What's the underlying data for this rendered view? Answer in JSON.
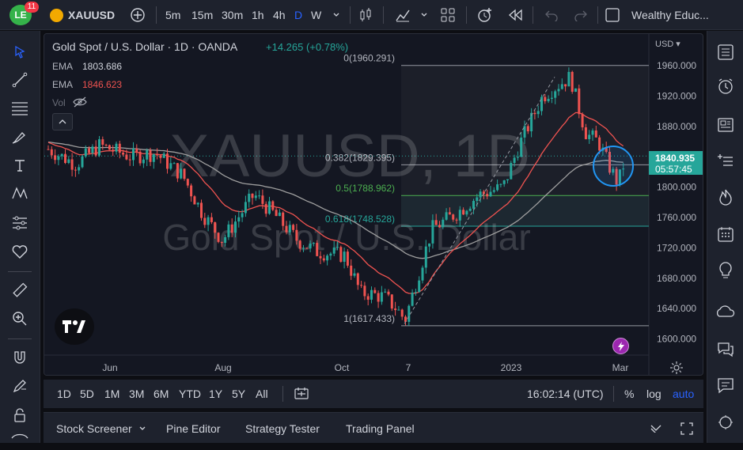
{
  "header": {
    "logo_badge": "11",
    "symbol": "XAUUSD",
    "intervals": [
      "5m",
      "15m",
      "30m",
      "1h",
      "4h",
      "D",
      "W"
    ],
    "active_interval": "D",
    "workspace": "Wealthy Educ..."
  },
  "legend": {
    "title": "Gold Spot / U.S. Dollar · 1D · OANDA",
    "change": "+14.265 (+0.78%)",
    "ema1_label": "EMA",
    "ema1_value": "1803.686",
    "ema2_label": "EMA",
    "ema2_value": "1846.623",
    "vol_label": "Vol"
  },
  "watermark": {
    "symbol": "XAUUSD, 1D",
    "name": "Gold Spot / U.S. Dollar"
  },
  "fib": {
    "level_0": "0(1960.291)",
    "level_382": "0.382(1829.395)",
    "level_5": "0.5(1788.962)",
    "level_618": "0.618(1748.528)",
    "level_1": "1(1617.433)"
  },
  "price_axis": {
    "currency": "USD",
    "ticks": [
      "1960.000",
      "1920.000",
      "1880.000",
      "1840.000",
      "1800.000",
      "1760.000",
      "1720.000",
      "1680.000",
      "1640.000",
      "1600.000"
    ],
    "current_price": "1840.935",
    "countdown": "05:57:45"
  },
  "time_axis": {
    "ticks": [
      "Jun",
      "Aug",
      "Oct",
      "7",
      "2023",
      "Mar"
    ]
  },
  "range_bar": {
    "ranges": [
      "1D",
      "5D",
      "1M",
      "3M",
      "6M",
      "YTD",
      "1Y",
      "5Y",
      "All"
    ],
    "clock": "16:02:14 (UTC)",
    "percent": "%",
    "log": "log",
    "auto": "auto"
  },
  "panels": {
    "tabs": [
      "Stock Screener",
      "Pine Editor",
      "Strategy Tester",
      "Trading Panel"
    ]
  },
  "chart_data": {
    "type": "candlestick",
    "symbol": "XAUUSD",
    "interval": "1D",
    "y_axis_ticks": [
      1960,
      1920,
      1880,
      1840,
      1800,
      1760,
      1720,
      1680,
      1640,
      1600
    ],
    "ylim": [
      1585,
      1995
    ],
    "x_axis_labels": [
      "Jun",
      "Aug",
      "Oct",
      "7",
      "2023",
      "Mar"
    ],
    "last_price": 1840.935,
    "fibonacci": [
      {
        "level": 0,
        "price": 1960.291
      },
      {
        "level": 0.382,
        "price": 1829.395
      },
      {
        "level": 0.5,
        "price": 1788.962
      },
      {
        "level": 0.618,
        "price": 1748.528
      },
      {
        "level": 1,
        "price": 1617.433
      }
    ],
    "ema_fast_last": 1846.623,
    "ema_slow_last": 1803.686,
    "colors": {
      "up": "#26a69a",
      "down": "#ef5350",
      "ema_fast": "#ef5350",
      "ema_slow": "#9e9e9e",
      "accent": "#2962ff"
    }
  }
}
